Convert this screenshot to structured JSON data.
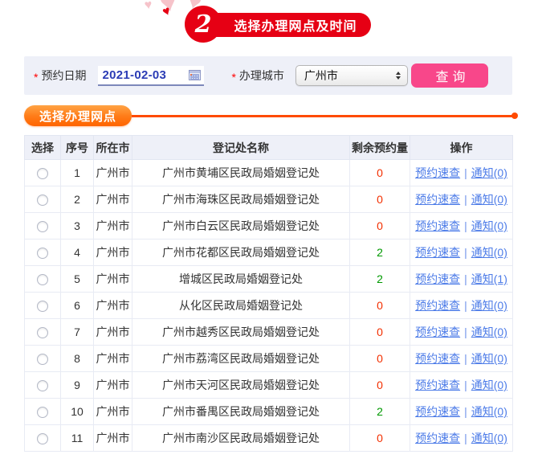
{
  "banner": {
    "step_number": "2",
    "title": "选择办理网点及时间"
  },
  "form": {
    "required_mark": "*",
    "date_label": "预约日期",
    "date_value": "2021-02-03",
    "calendar_icon": "calendar-icon",
    "city_label": "办理城市",
    "city_value": "广州市",
    "query_button": "查询"
  },
  "section": {
    "title": "选择办理网点"
  },
  "table": {
    "headers": [
      "选择",
      "序号",
      "所在市",
      "登记处名称",
      "剩余预约量",
      "操作"
    ],
    "ops": {
      "quick_check_label": "预约速查",
      "separator": "|"
    },
    "rows": [
      {
        "no": "1",
        "city": "广州市",
        "name": "广州市黄埔区民政局婚姻登记处",
        "remaining": "0",
        "remaining_color": "red",
        "notice_label": "通知(0)"
      },
      {
        "no": "2",
        "city": "广州市",
        "name": "广州市海珠区民政局婚姻登记处",
        "remaining": "0",
        "remaining_color": "red",
        "notice_label": "通知(0)"
      },
      {
        "no": "3",
        "city": "广州市",
        "name": "广州市白云区民政局婚姻登记处",
        "remaining": "0",
        "remaining_color": "red",
        "notice_label": "通知(0)"
      },
      {
        "no": "4",
        "city": "广州市",
        "name": "广州市花都区民政局婚姻登记处",
        "remaining": "2",
        "remaining_color": "green",
        "notice_label": "通知(0)"
      },
      {
        "no": "5",
        "city": "广州市",
        "name": "增城区民政局婚姻登记处",
        "remaining": "2",
        "remaining_color": "green",
        "notice_label": "通知(1)"
      },
      {
        "no": "6",
        "city": "广州市",
        "name": "从化区民政局婚姻登记处",
        "remaining": "0",
        "remaining_color": "red",
        "notice_label": "通知(0)"
      },
      {
        "no": "7",
        "city": "广州市",
        "name": "广州市越秀区民政局婚姻登记处",
        "remaining": "0",
        "remaining_color": "red",
        "notice_label": "通知(0)"
      },
      {
        "no": "8",
        "city": "广州市",
        "name": "广州市荔湾区民政局婚姻登记处",
        "remaining": "0",
        "remaining_color": "red",
        "notice_label": "通知(0)"
      },
      {
        "no": "9",
        "city": "广州市",
        "name": "广州市天河区民政局婚姻登记处",
        "remaining": "0",
        "remaining_color": "red",
        "notice_label": "通知(0)"
      },
      {
        "no": "10",
        "city": "广州市",
        "name": "广州市番禺区民政局婚姻登记处",
        "remaining": "2",
        "remaining_color": "green",
        "notice_label": "通知(0)"
      },
      {
        "no": "11",
        "city": "广州市",
        "name": "广州市南沙区民政局婚姻登记处",
        "remaining": "0",
        "remaining_color": "red",
        "notice_label": "通知(0)"
      }
    ]
  },
  "colors": {
    "banner_red": "#e60014",
    "heart_pale_pink": "#f6c3ca",
    "filter_bar_bg": "#eef0f8",
    "date_text_blue": "#2b3cb5",
    "query_button_pink": "#f8478a",
    "section_orange_start": "#ffa344",
    "section_orange_end": "#ff6400",
    "section_line": "#ff4a00",
    "table_header_bg": "#eef0f8",
    "link_blue": "#4d7ce8",
    "remaining_red": "#f32f00",
    "remaining_green": "#009900"
  }
}
